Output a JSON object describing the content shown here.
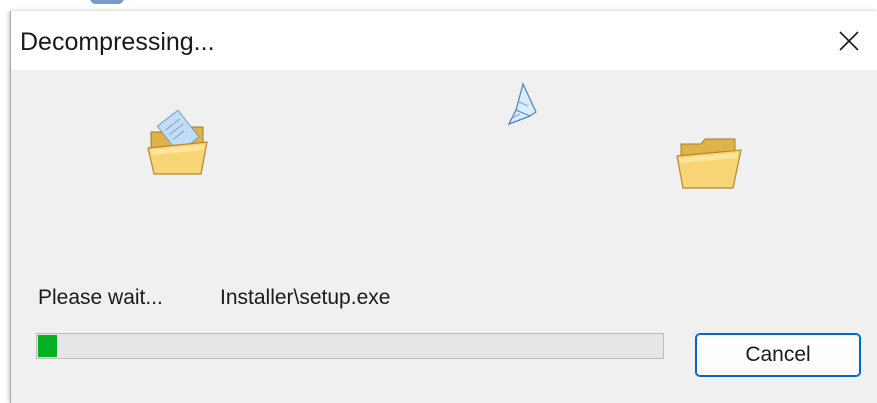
{
  "dialog": {
    "title": "Decompressing...",
    "status_text": "Please wait...",
    "current_file": "Installer\\setup.exe",
    "cancel_label": "Cancel",
    "progress": 0.03
  },
  "colors": {
    "progress_fill": "#06b025",
    "button_border": "#0067c0",
    "dialog_background": "#f0f0f0",
    "titlebar_background": "#ffffff"
  },
  "icons": {
    "close": "close-icon",
    "source_folder": "open-folder-with-document-icon",
    "flying_document": "flying-document-icon",
    "destination_folder": "folder-icon"
  }
}
